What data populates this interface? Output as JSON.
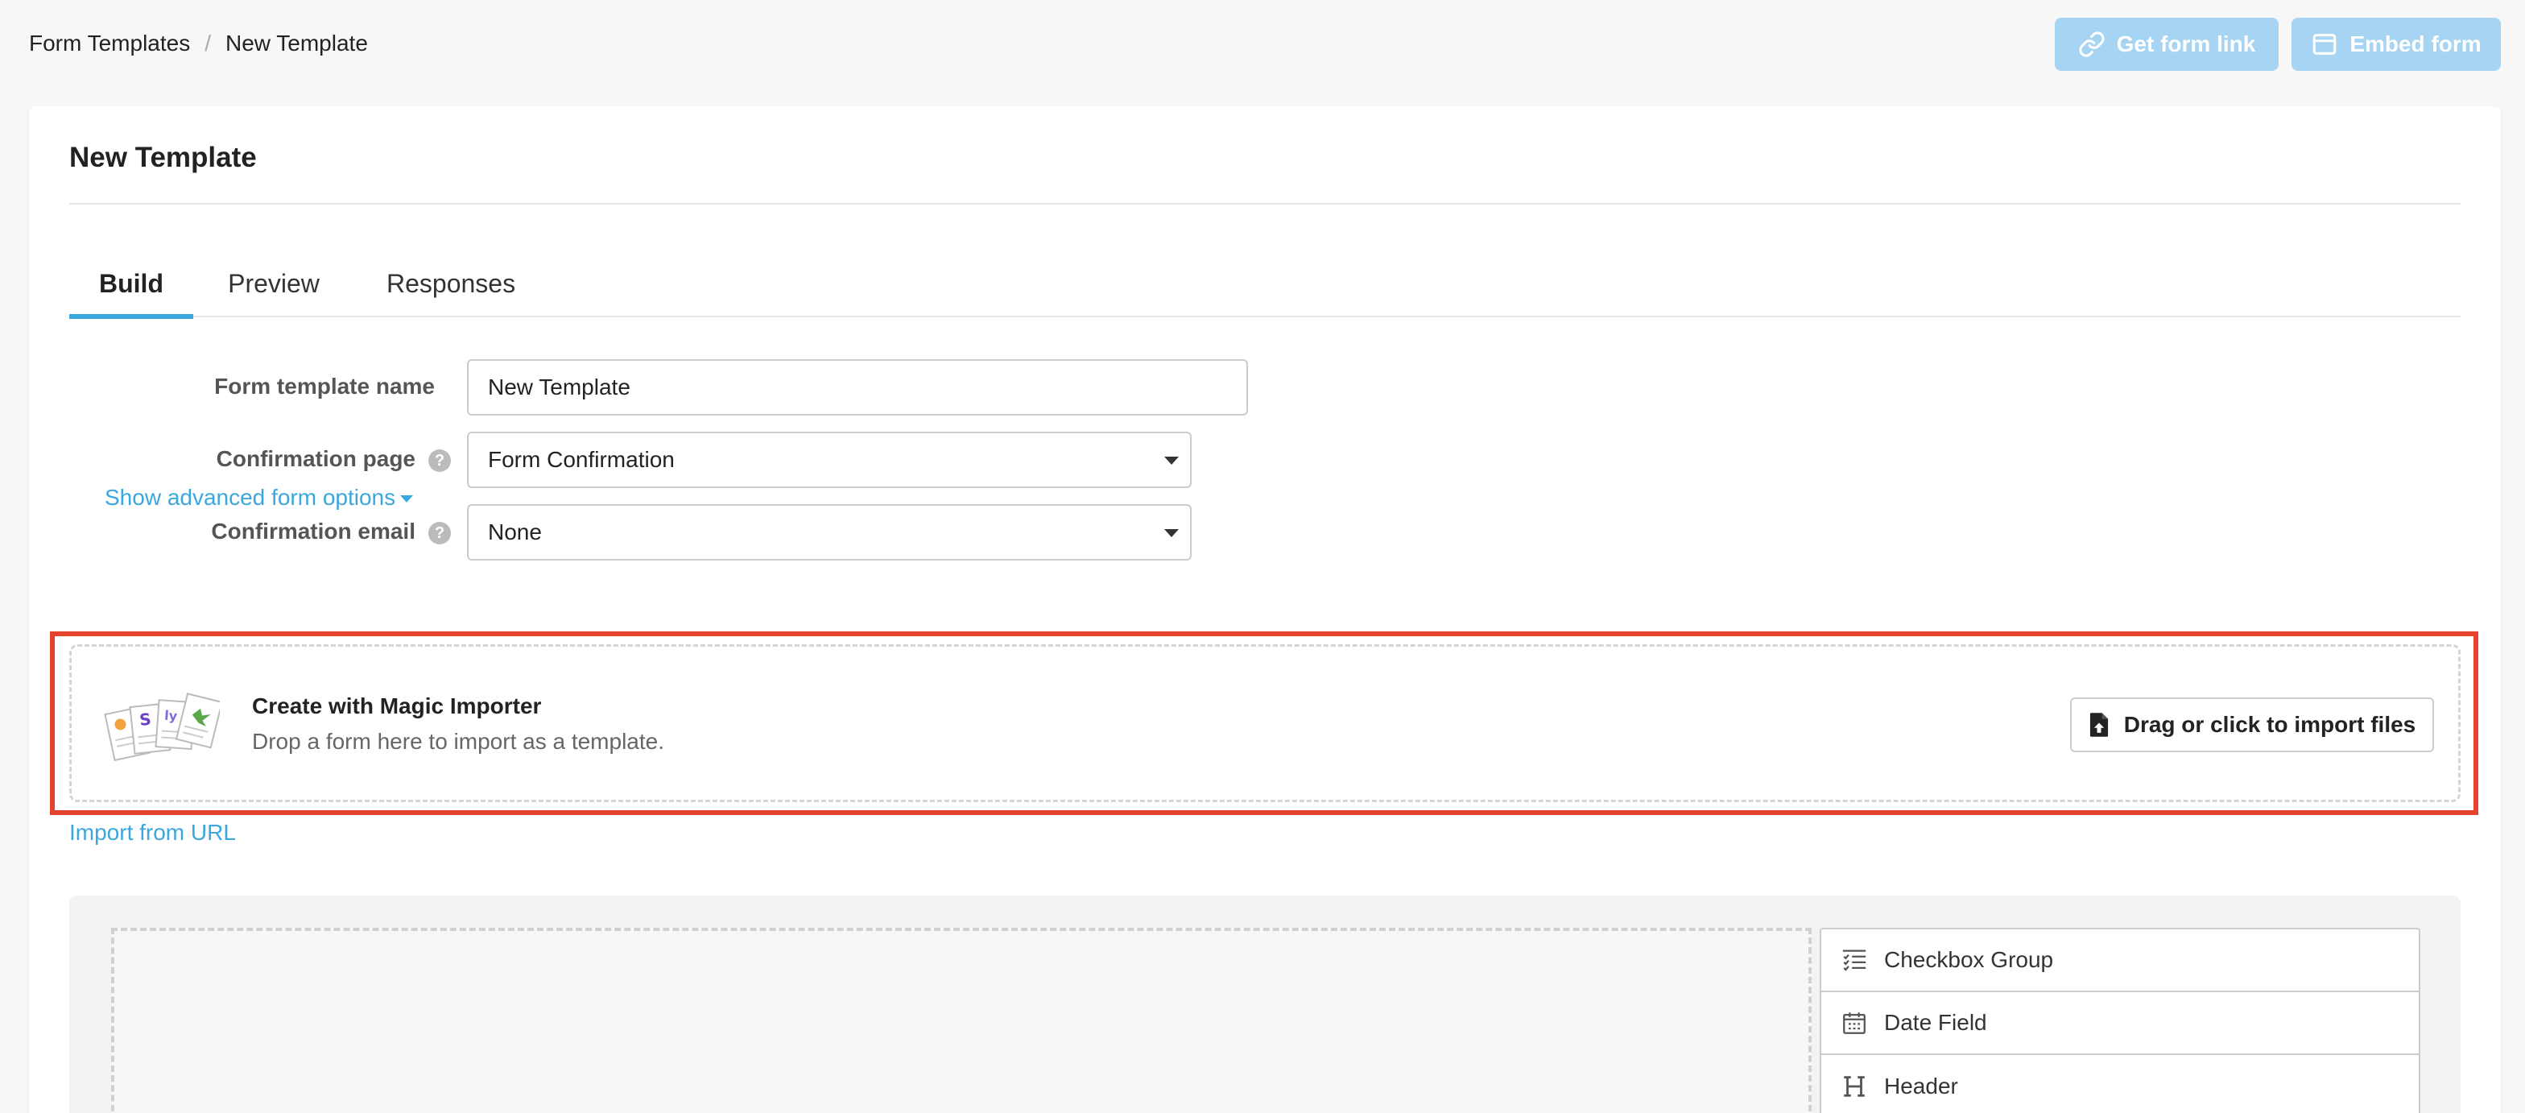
{
  "breadcrumb": {
    "parent": "Form Templates",
    "separator": "/",
    "current": "New Template"
  },
  "header_actions": {
    "get_link_label": "Get form link",
    "embed_label": "Embed form"
  },
  "card": {
    "title": "New Template"
  },
  "tabs": [
    {
      "label": "Build",
      "active": true
    },
    {
      "label": "Preview",
      "active": false
    },
    {
      "label": "Responses",
      "active": false
    }
  ],
  "form": {
    "name_label": "Form template name",
    "name_value": "New Template",
    "confirmation_page_label": "Confirmation page",
    "confirmation_page_value": "Form Confirmation",
    "confirmation_email_label": "Confirmation email",
    "confirmation_email_value": "None",
    "help_glyph": "?",
    "advanced_link": "Show advanced form options"
  },
  "importer": {
    "title": "Create with Magic Importer",
    "subtitle": "Drop a form here to import as a template.",
    "button_label": "Drag or click to import files",
    "import_url_link": "Import from URL"
  },
  "palette": [
    {
      "label": "Checkbox Group",
      "icon": "checkbox-list-icon"
    },
    {
      "label": "Date Field",
      "icon": "calendar-icon"
    },
    {
      "label": "Header",
      "icon": "heading-icon"
    }
  ],
  "colors": {
    "accent": "#3aa7de",
    "disabled_button": "#a6d4f2",
    "highlight": "#e5432d"
  }
}
